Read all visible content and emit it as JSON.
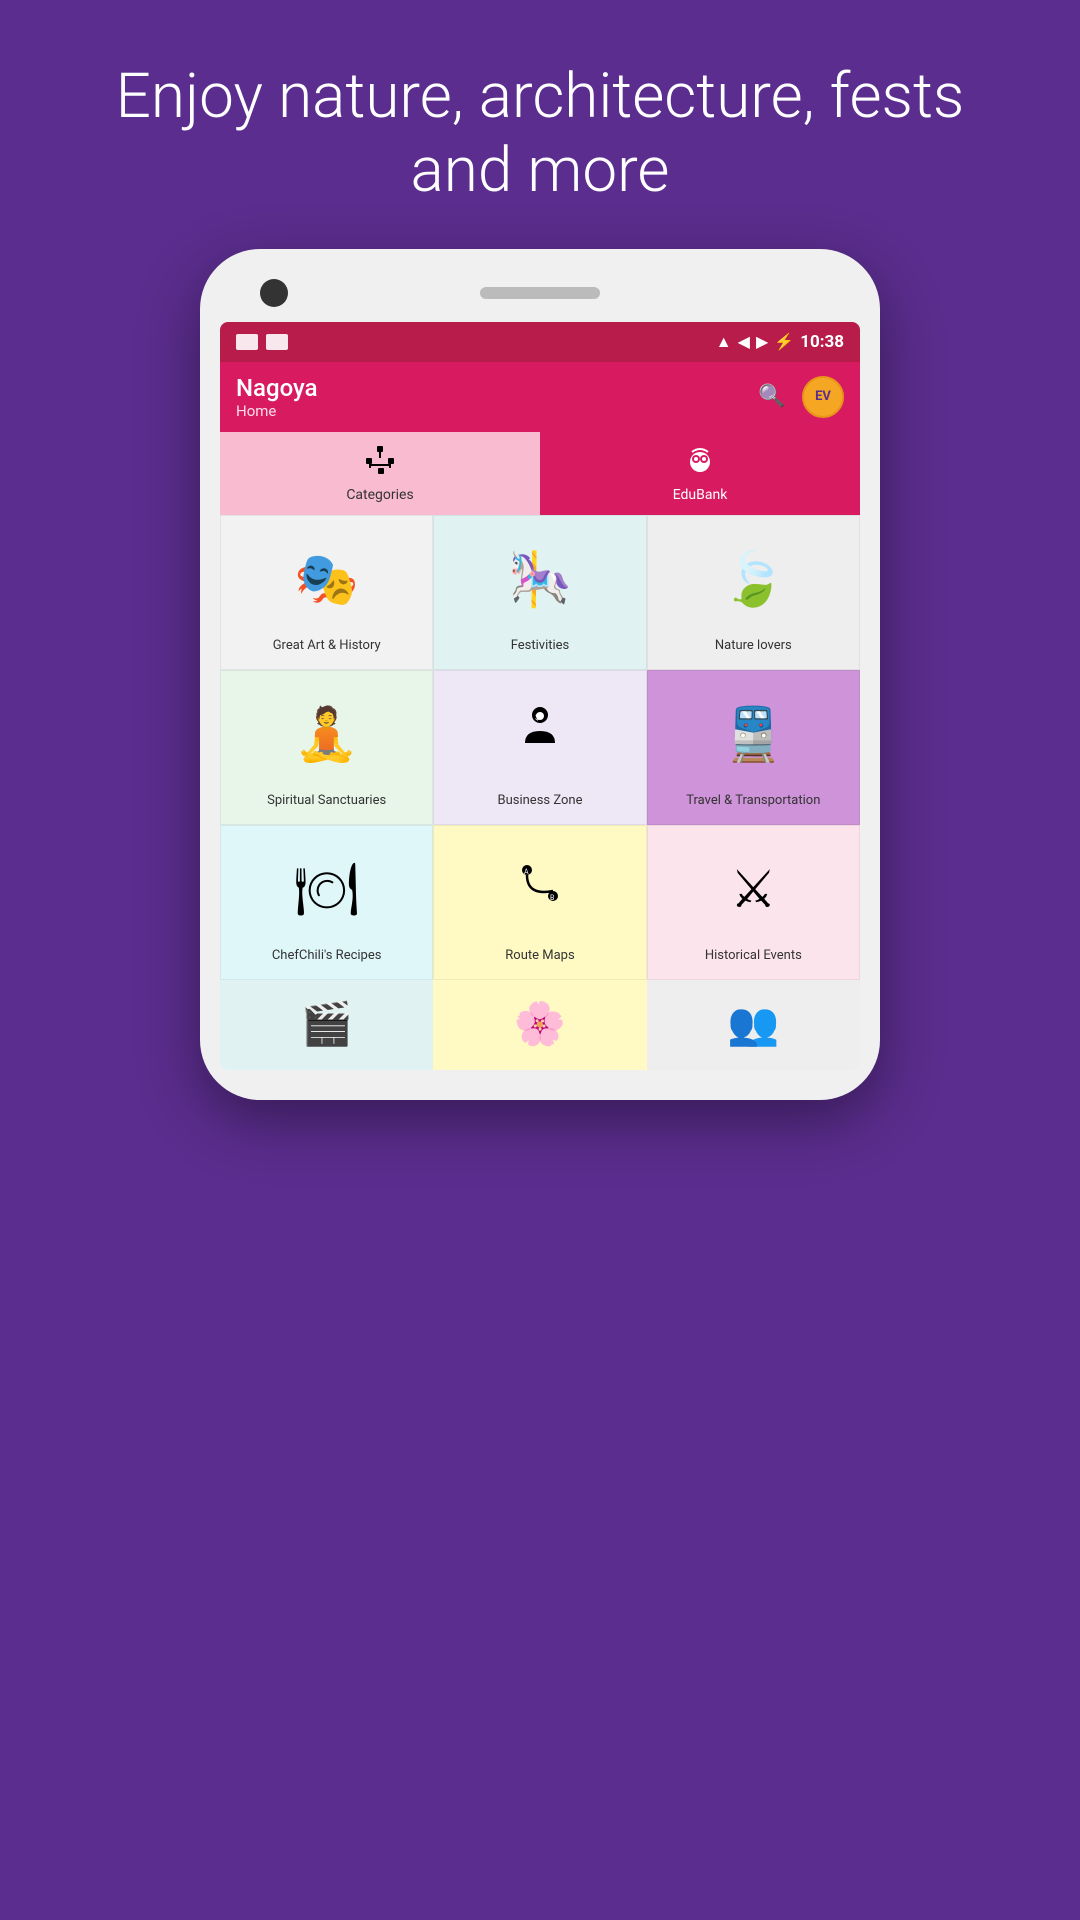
{
  "hero": {
    "text": "Enjoy nature, architecture, fests and more"
  },
  "status_bar": {
    "time": "10:38",
    "icons": [
      "wifi",
      "signal",
      "signal-full",
      "battery"
    ]
  },
  "app_bar": {
    "title": "Nagoya",
    "subtitle": "Home",
    "avatar_label": "EV"
  },
  "tabs": [
    {
      "id": "categories",
      "label": "Categories",
      "icon": "🔲",
      "active": false
    },
    {
      "id": "edubank",
      "label": "EduBank",
      "icon": "🦉",
      "active": true
    }
  ],
  "categories": [
    {
      "id": "great-art",
      "label": "Great Art & History",
      "icon": "🎭",
      "color": "c-gray"
    },
    {
      "id": "festivities",
      "label": "Festivities",
      "icon": "🎠",
      "color": "c-teal"
    },
    {
      "id": "nature",
      "label": "Nature lovers",
      "icon": "🍃",
      "color": "c-lgray"
    },
    {
      "id": "spiritual",
      "label": "Spiritual Sanctuaries",
      "icon": "🧘",
      "color": "c-lgreen"
    },
    {
      "id": "business",
      "label": "Business Zone",
      "icon": "💼",
      "color": "c-lpurple"
    },
    {
      "id": "travel",
      "label": "Travel & Transportation",
      "icon": "🚆",
      "color": "c-pink-active"
    },
    {
      "id": "chef",
      "label": "ChefChili's Recipes",
      "icon": "🍽",
      "color": "c-cyan"
    },
    {
      "id": "route",
      "label": "Route Maps",
      "icon": "🗺",
      "color": "c-yellow"
    },
    {
      "id": "historical",
      "label": "Historical Events",
      "icon": "⚔",
      "color": "c-peach"
    }
  ],
  "partial_row": [
    {
      "id": "partial1",
      "icon": "🎬",
      "color": "c-teal"
    },
    {
      "id": "partial2",
      "icon": "🌸",
      "color": "c-yellow"
    },
    {
      "id": "partial3",
      "icon": "👥",
      "color": "c-lgray"
    }
  ],
  "fab": {
    "icon": "👤"
  }
}
